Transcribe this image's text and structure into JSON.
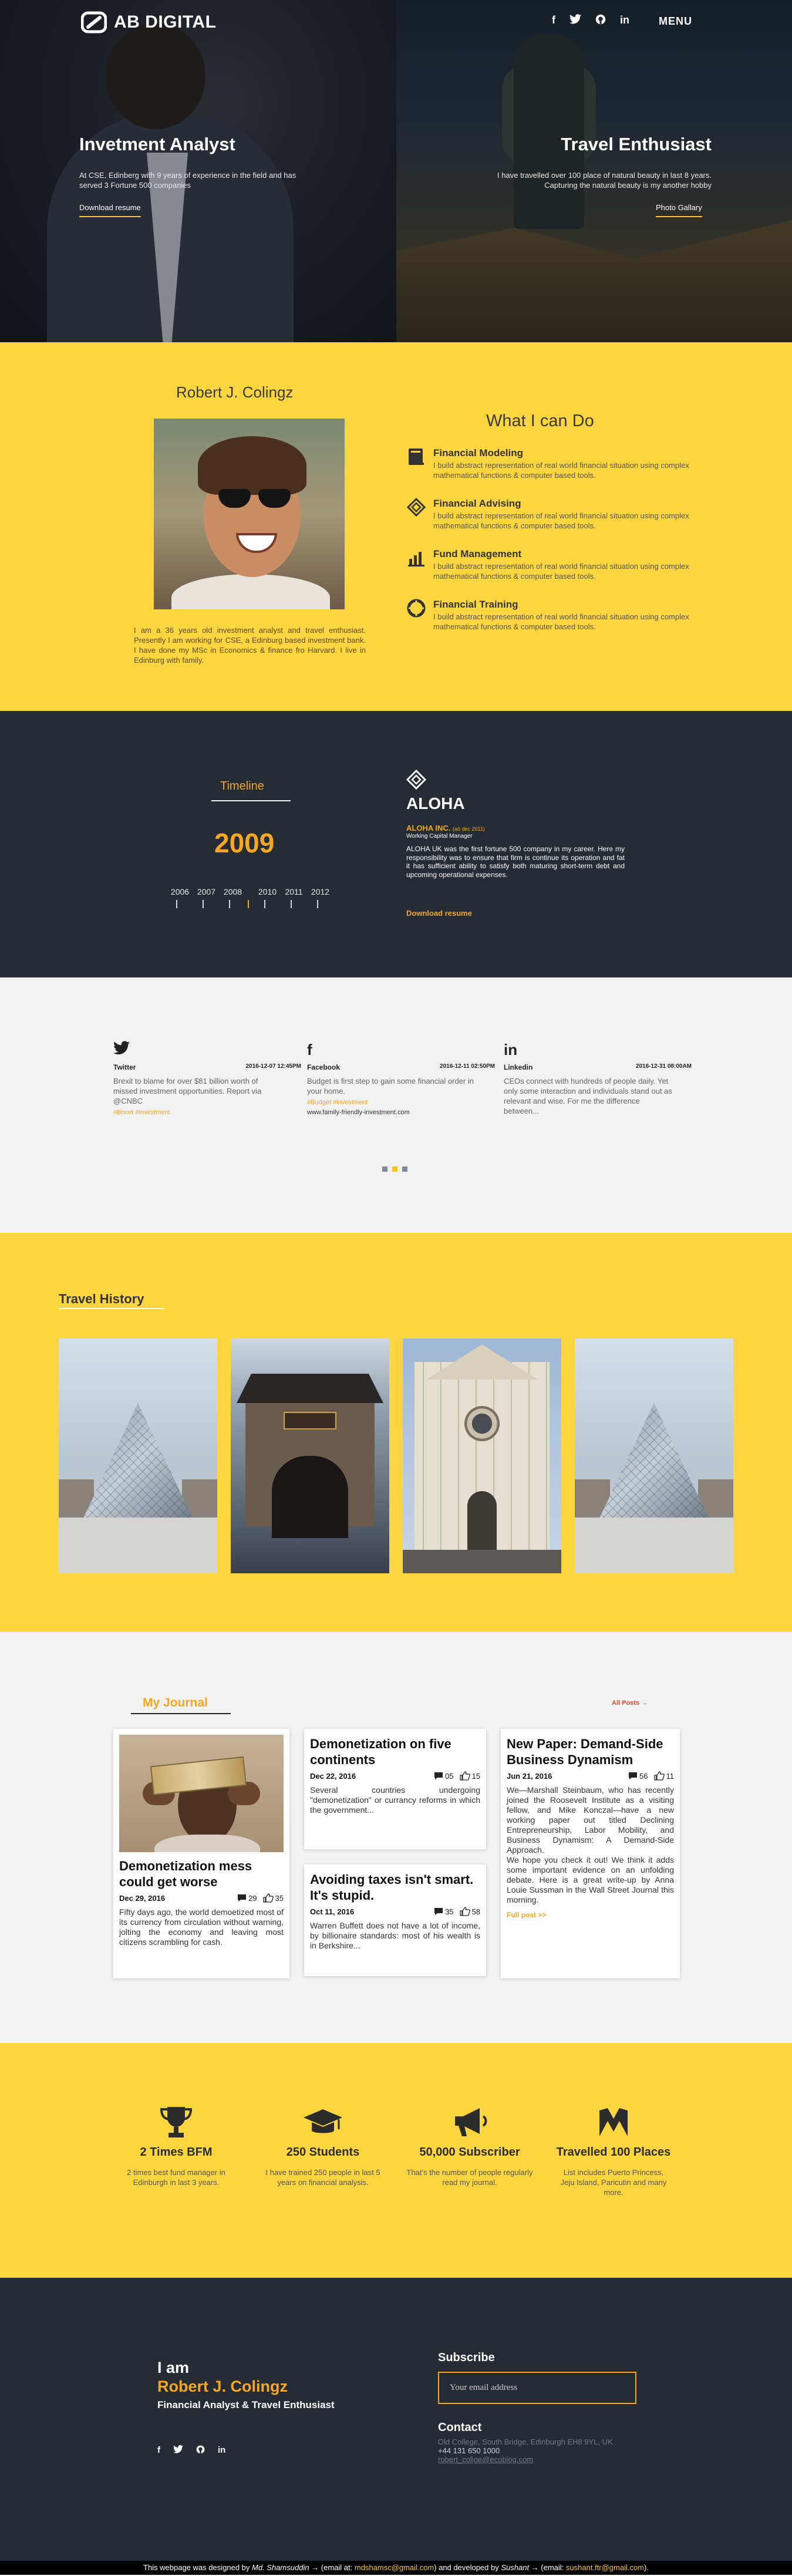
{
  "brand": {
    "name": "AB DIGITAL"
  },
  "nav": {
    "social": [
      "f",
      "twitter",
      "github",
      "in"
    ],
    "menu_label": "MENU"
  },
  "hero": {
    "left": {
      "title": "Invetment Analyst",
      "description": "At CSE, Edinberg with 9 years of experience in the field and has served 3 Fortune 500 companies",
      "link": "Download resume"
    },
    "right": {
      "title": "Travel Enthusiast",
      "description": "I have travelled over 100 place of natural beauty in last 8 years. Capturing the natural beauty is my another hobby",
      "link": "Photo Gallary"
    }
  },
  "about": {
    "name": "Robert J. Colingz",
    "bio": "I am a 36 years old investment analyst and travel enthusiast. Presently I am working for CSE, a Edinburg based investment bank. I have done my MSc in Economics & finance fro Harvard. I live in Edinburg with family.",
    "cando_title": "What I can Do",
    "skills": [
      {
        "name": "Financial Modeling",
        "icon": "book-icon",
        "description": "I build abstract representation of real world financial situation using complex mathematical functions & computer based tools."
      },
      {
        "name": "Financial Advising",
        "icon": "advise-icon",
        "description": "I build abstract representation of real world financial situation using complex mathematical functions & computer based tools."
      },
      {
        "name": "Fund Management",
        "icon": "bar-chart-icon",
        "description": "I build abstract representation of real world financial situation using complex mathematical functions & computer based tools."
      },
      {
        "name": "Financial Training",
        "icon": "lifebuoy-icon",
        "description": "I build abstract representation of real world financial situation using complex mathematical functions & computer based tools."
      }
    ]
  },
  "timeline": {
    "heading": "Timeline",
    "selected_year": "2009",
    "years": [
      "2006",
      "2007",
      "2008",
      "2010",
      "2011",
      "2012"
    ],
    "company": "ALOHA",
    "company_full": "ALOHA INC.",
    "period": "(aŭ dec 2011)",
    "role": "Working Capital Manager",
    "description": "ALOHA UK was the first fortune 500 company in my career. Here my responsibility was to ensure that firm is continue its operation and fat it has sufficient ability to satisfy both maturing short-term debt and upcoming operational expenses.",
    "link": "Download resume"
  },
  "social_feed": {
    "posts": [
      {
        "network": "Twitter",
        "icon": "twitter-icon",
        "date": "2016-12-07 12:45PM",
        "text": "Brexit to blame for over $81 billion worth of missed investment opportunities. Report via @CNBC",
        "tags": "#Brexit #investment",
        "url": ""
      },
      {
        "network": "Facebook",
        "icon": "facebook-icon",
        "date": "2016-12-11 02:50PM",
        "text": "Budget is first step to gain some financial order in your home.",
        "tags": "#Budget #investment",
        "url": "www.family-friendly-investment.com"
      },
      {
        "network": "Linkedin",
        "icon": "linkedin-icon",
        "date": "2016-12-31 08:00AM",
        "text": "CEOs connect with hundreds of people daily. Yet only some interaction and individuals stand out as relevant and wise. For me the difference between...",
        "tags": "",
        "url": ""
      }
    ],
    "active_dot": 1
  },
  "travel": {
    "heading": "Travel History",
    "photos": [
      "louvre-pyramid",
      "chinese-gate",
      "florence-duomo",
      "louvre-pyramid"
    ]
  },
  "journal": {
    "heading": "My Journal",
    "all_posts": "All Posts →",
    "cards": [
      {
        "title": "Demonetization mess could get worse",
        "date": "Dec 29, 2016",
        "comments": "29",
        "likes": "35",
        "text": "Fifty days ago, the world demoetized most of its currency from circulation without warning, jolting the economy and leaving most citizens scrambling for cash.",
        "more": ""
      },
      {
        "title": "Demonetization on five continents",
        "date": "Dec 22, 2016",
        "comments": "05",
        "likes": "15",
        "text": "Several countries undergoing \"demonetization\" or currancy reforms in which the government...",
        "more": ""
      },
      {
        "title": "Avoiding taxes isn't smart. It's stupid.",
        "date": "Oct 11, 2016",
        "comments": "35",
        "likes": "58",
        "text": "Warren Buffett does not have a lot of income, by billionaire standards: most of his wealth is in Berkshire...",
        "more": ""
      },
      {
        "title": "New Paper: Demand-Side Business Dynamism",
        "date": "Jun 21, 2016",
        "comments": "56",
        "likes": "11",
        "text": "We—Marshall Steinbaum, who has recently joined the Roosevelt Institute as a visiting fellow, and Mike Konczal—have a new working paper out titled Declining Entrepreneurship, Labor Mobility, and Business Dynamism: A Demand-Side Approach.\nWe hope you check it out! We think it adds some important evidence on an unfolding debate. Here is a great write-up by Anna Louie Sussman in the Wall Street Journal this morning.",
        "more": "Full post >>"
      }
    ]
  },
  "stats": [
    {
      "icon": "trophy-icon",
      "title": "2 Times BFM",
      "description": "2 times best fund manager in Edinburgh in last 3 years."
    },
    {
      "icon": "graduation-cap-icon",
      "title": "250 Students",
      "description": "I have trained 250 people in last 5 years on financial analysis."
    },
    {
      "icon": "megaphone-icon",
      "title": "50,000 Subscriber",
      "description": "That's the number of people regularly read my journal."
    },
    {
      "icon": "map-marker-icon",
      "title": "Travelled 100 Places",
      "description": "List includes Puerto Princess, Jeju Island, Paricutin and many more."
    }
  ],
  "footer": {
    "iam": "I am",
    "name": "Robert J. Colingz",
    "role": "Financial Analyst & Travel Enthusiast",
    "subscribe_title": "Subscribe",
    "subscribe_placeholder": "Your email address",
    "contact_title": "Contact",
    "address": "Old College, South Bridge, Edinburgh EH8 9YL, UK",
    "phone": "+44 131 650 1000",
    "email": "robert_colige@ecoblog.com"
  },
  "credits": {
    "p1": "This webpage was designed by ",
    "designer": "Md. Shamsuddin",
    "p2": " → (email at: ",
    "designer_email": "mdshamsc@gmail.com",
    "p3": ") and developed by ",
    "developer": "Sushant",
    "p4": " → (email: ",
    "developer_email": "sushant.ftr@gmail.com",
    "p5": ")."
  },
  "colors": {
    "accent": "#f5a623",
    "yellow": "#fdd53e",
    "dark": "#262c33"
  }
}
